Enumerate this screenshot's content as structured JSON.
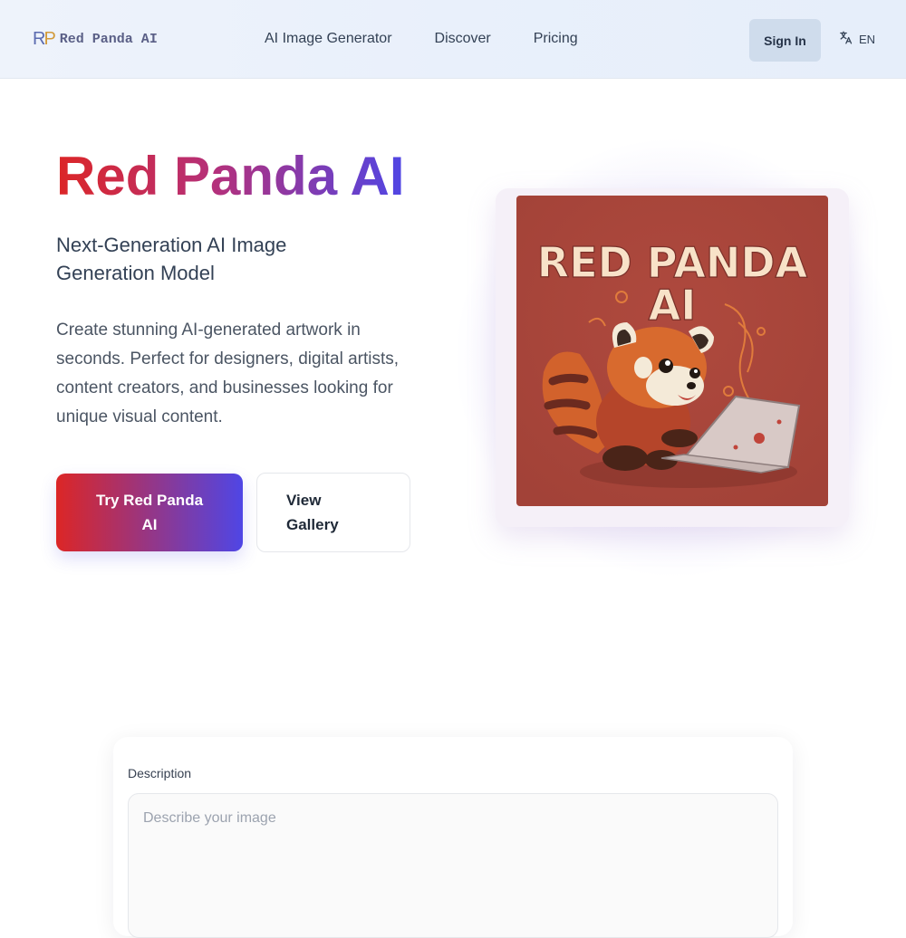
{
  "header": {
    "logo_mark_r": "R",
    "logo_mark_p": "P",
    "logo_text": "Red Panda AI",
    "nav": [
      "AI Image Generator",
      "Discover",
      "Pricing"
    ],
    "signin_label": "Sign In",
    "lang_label": "EN",
    "icons": [
      "translate-icon"
    ]
  },
  "hero": {
    "title": "Red Panda AI",
    "subtitle": "Next-Generation AI Image Generation Model",
    "description": "Create stunning AI-generated artwork in seconds. Perfect for designers, digital artists, content creators, and businesses looking for unique visual content.",
    "primary_button": "Try Red Panda AI",
    "secondary_button": "View Gallery",
    "image_text_line1": "RED PANDA",
    "image_text_line2": "AI"
  },
  "form": {
    "label": "Description",
    "placeholder": "Describe your image"
  },
  "colors": {
    "brand_red": "#dc2626",
    "brand_indigo": "#4f46e5",
    "art_background": "#a9453a"
  }
}
